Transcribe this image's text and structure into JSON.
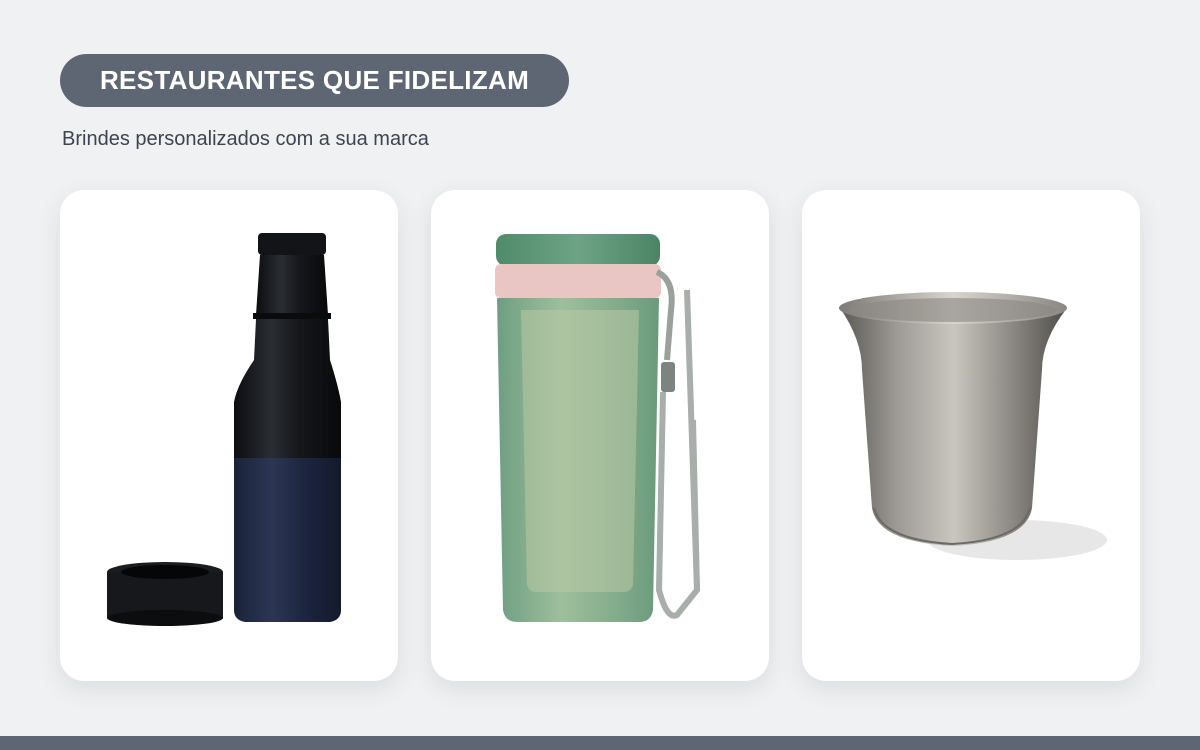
{
  "header": {
    "title": "RESTAURANTES QUE FIDELIZAM",
    "subtitle": "Brindes personalizados com a sua marca"
  },
  "colors": {
    "background": "#f0f1f3",
    "pill": "#5f6673",
    "card": "#ffffff",
    "footer_bar": "#5f6673"
  },
  "products": [
    {
      "icon": "insulated-bottle-cooler-image"
    },
    {
      "icon": "green-tumbler-with-strap-image"
    },
    {
      "icon": "stainless-steel-cup-image"
    }
  ]
}
